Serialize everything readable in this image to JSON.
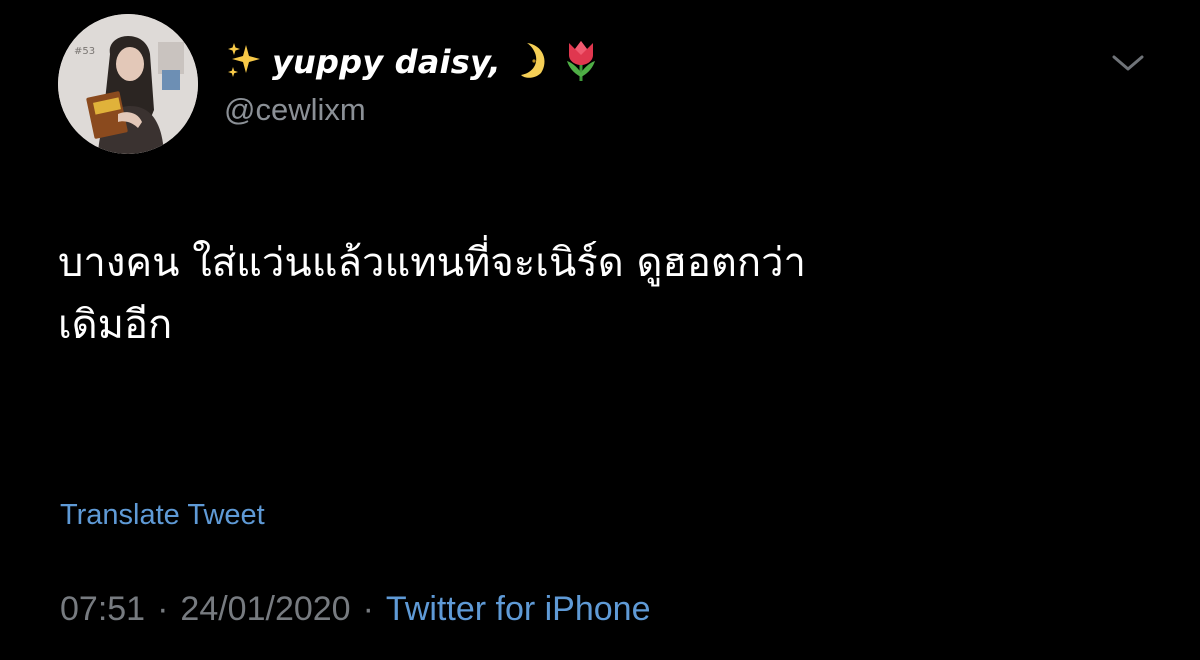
{
  "tweet": {
    "author": {
      "display_name": "yuppy daisy,",
      "handle": "@cewlixm",
      "avatar_icon": "avatar-photo",
      "name_emojis": [
        "sparkles-icon",
        "crescent-moon-icon",
        "tulip-icon"
      ]
    },
    "text_line_1": "บางคน ใส่แว่นแล้วแทนที่จะเนิร์ด ดูฮอตกว่า",
    "text_line_2": "เดิมอีก",
    "translate_label": "Translate Tweet",
    "time": "07:51",
    "separator": "·",
    "date": "24/01/2020",
    "source": "Twitter for iPhone"
  },
  "colors": {
    "background": "#000000",
    "text": "#ffffff",
    "muted": "#777b80",
    "link": "#5f9ad6"
  }
}
